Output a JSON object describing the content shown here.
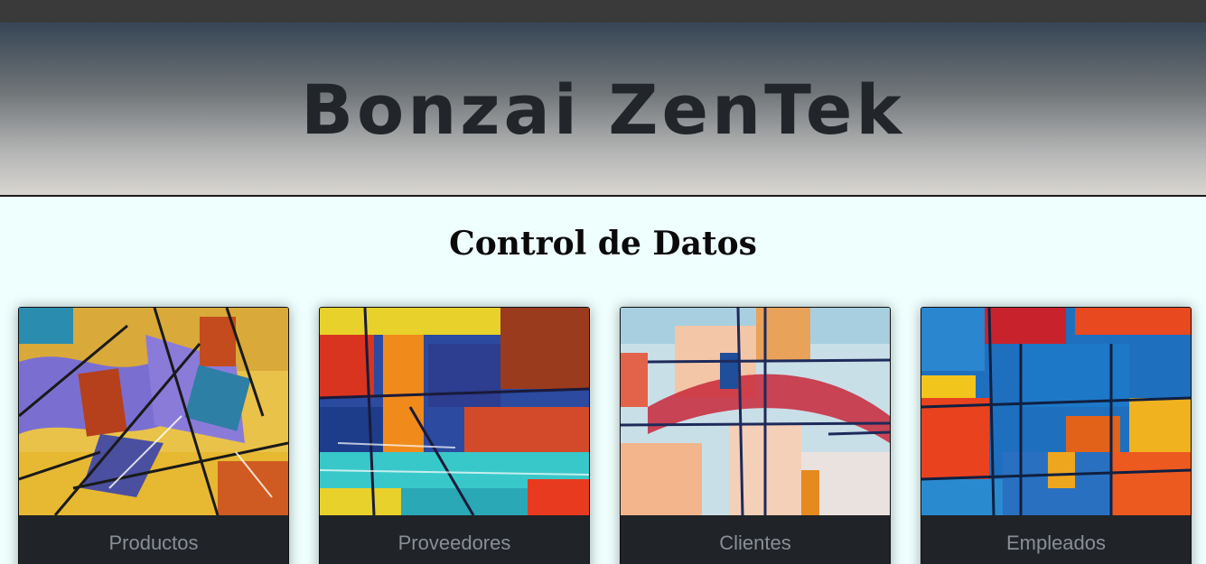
{
  "header": {
    "brand": "Bonzai ZenTek"
  },
  "main": {
    "title": "Control de Datos",
    "cards": [
      {
        "label": "Productos",
        "image": "abstract-painting-1"
      },
      {
        "label": "Proveedores",
        "image": "abstract-painting-2"
      },
      {
        "label": "Clientes",
        "image": "abstract-painting-3"
      },
      {
        "label": "Empleados",
        "image": "abstract-painting-4"
      }
    ]
  },
  "colors": {
    "topbar": "#3a3a3a",
    "hero_top": "#364555",
    "hero_bottom": "#d8d5d1",
    "page_bg": "#effffe",
    "card_footer": "#202327",
    "card_label": "#8a8f95"
  }
}
